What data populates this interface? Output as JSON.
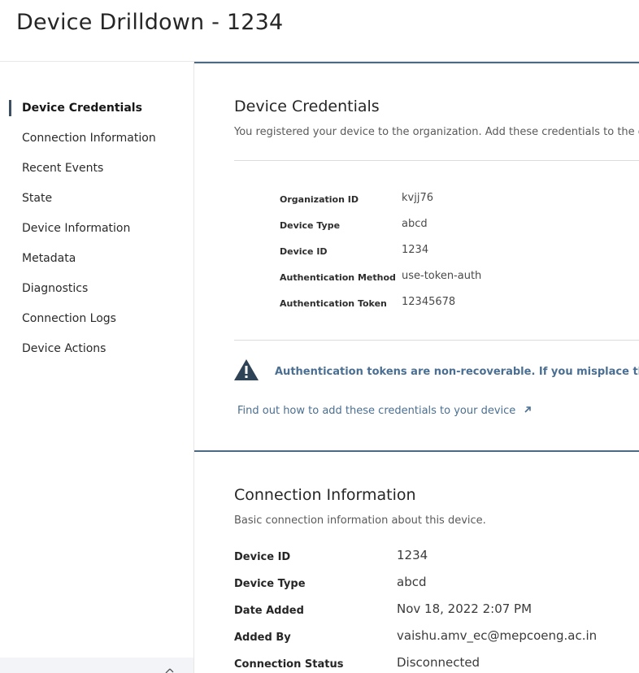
{
  "page": {
    "title": "Device Drilldown - 1234"
  },
  "sidebar": {
    "items": [
      {
        "label": "Device Credentials",
        "active": true
      },
      {
        "label": "Connection Information"
      },
      {
        "label": "Recent Events"
      },
      {
        "label": "State"
      },
      {
        "label": "Device Information"
      },
      {
        "label": "Metadata"
      },
      {
        "label": "Diagnostics"
      },
      {
        "label": "Connection Logs"
      },
      {
        "label": "Device Actions"
      }
    ],
    "collapse_icon": "chevron-icon"
  },
  "credentials": {
    "title": "Device Credentials",
    "description": "You registered your device to the organization. Add these credentials to the devi",
    "fields": [
      {
        "label": "Organization ID",
        "value": "kvjj76"
      },
      {
        "label": "Device Type",
        "value": "abcd"
      },
      {
        "label": "Device ID",
        "value": "1234"
      },
      {
        "label": "Authentication Method",
        "value": "use-token-auth"
      },
      {
        "label": "Authentication Token",
        "value": "12345678"
      }
    ],
    "warning_icon": "warning-icon",
    "warning_text": "Authentication tokens are non-recoverable. If you misplace this token,",
    "link_text": "Find out how to add these credentials to your device",
    "link_icon": "arrow-up-right-icon"
  },
  "connection": {
    "title": "Connection Information",
    "description": "Basic connection information about this device.",
    "fields": [
      {
        "label": "Device ID",
        "value": "1234"
      },
      {
        "label": "Device Type",
        "value": "abcd"
      },
      {
        "label": "Date Added",
        "value": "Nov 18, 2022 2:07 PM"
      },
      {
        "label": "Added By",
        "value": "vaishu.amv_ec@mepcoeng.ac.in"
      },
      {
        "label": "Connection Status",
        "value": "Disconnected"
      }
    ]
  },
  "colors": {
    "accent": "#4c6a86",
    "link": "#4a6f93",
    "warning_icon": "#2f4356"
  }
}
